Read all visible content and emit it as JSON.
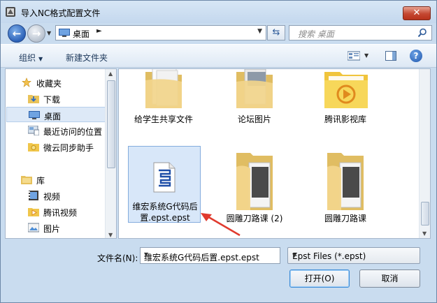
{
  "window": {
    "title": "导入NC格式配置文件",
    "close_label": "✕"
  },
  "address": {
    "location": "桌面",
    "separator": "►",
    "search_placeholder": "搜索 桌面"
  },
  "toolbar": {
    "organize_label": "组织",
    "new_folder_label": "新建文件夹",
    "help_label": "?"
  },
  "sidebar": {
    "items": [
      {
        "label": "收藏夹",
        "icon": "star-icon",
        "header": true
      },
      {
        "label": "下载",
        "icon": "download-folder-icon"
      },
      {
        "label": "桌面",
        "icon": "desktop-icon",
        "selected": true
      },
      {
        "label": "最近访问的位置",
        "icon": "recent-places-icon"
      },
      {
        "label": "微云同步助手",
        "icon": "weiyun-icon"
      },
      {
        "label": "库",
        "icon": "library-icon",
        "header": true
      },
      {
        "label": "视频",
        "icon": "video-icon"
      },
      {
        "label": "腾讯视频",
        "icon": "tencent-video-icon"
      },
      {
        "label": "图片",
        "icon": "pictures-icon"
      }
    ]
  },
  "files": [
    {
      "label": "给学生共享文件",
      "icon": "folder-icon"
    },
    {
      "label": "论坛图片",
      "icon": "folder-icon"
    },
    {
      "label": "腾讯影视库",
      "icon": "tencent-video-folder-icon"
    },
    {
      "label": "维宏系统G代码后置.epst.epst",
      "label_line1": "维宏系统G代码后",
      "label_line2": "置.epst.epst",
      "icon": "epst-file-icon",
      "selected": true
    },
    {
      "label": "圆雕刀路课 (2)",
      "icon": "folder-icon"
    },
    {
      "label": "圆雕刀路课",
      "icon": "folder-icon"
    }
  ],
  "bottom": {
    "filename_label": "文件名(N):",
    "filename_value": "维宏系统G代码后置.epst.epst",
    "filetype_value": "Epst Files (*.epst)",
    "open_label": "打开(O)",
    "cancel_label": "取消"
  },
  "colors": {
    "accent": "#2c62b8",
    "selection": "#d8e7f9",
    "annotation_arrow": "#e03a2e",
    "close_button": "#c44731"
  }
}
